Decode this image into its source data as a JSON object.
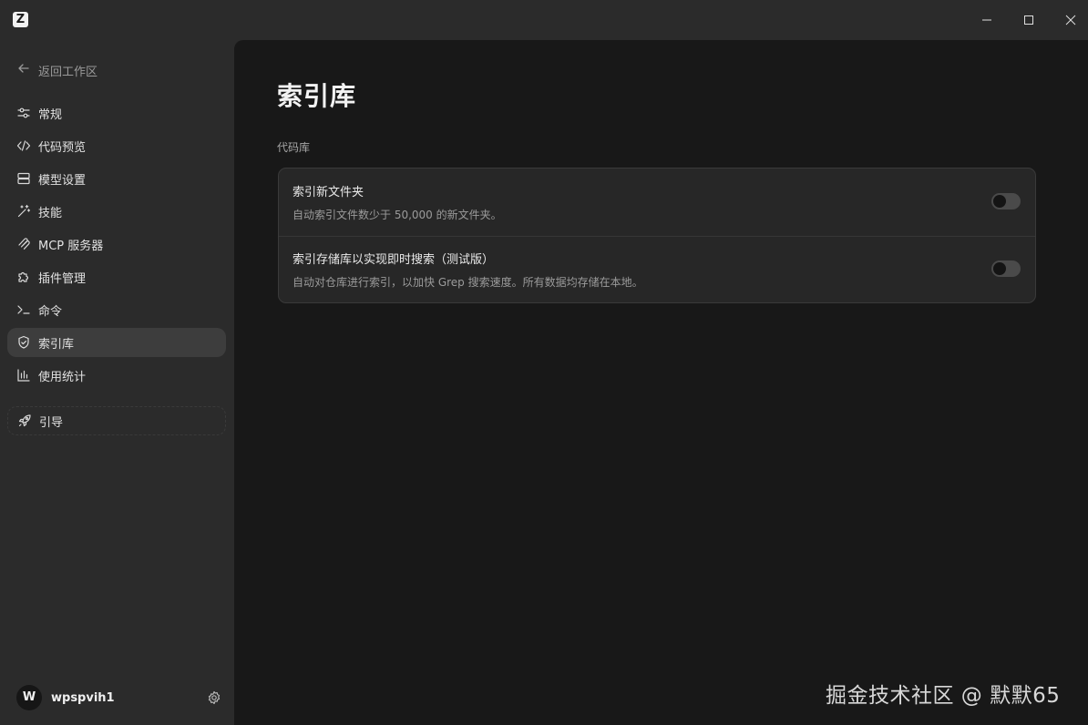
{
  "app": {
    "logo_letter": "Z"
  },
  "window_controls": {
    "minimize_icon": "minimize-icon",
    "maximize_icon": "maximize-icon",
    "close_icon": "close-icon"
  },
  "sidebar": {
    "back_label": "返回工作区",
    "items": [
      {
        "label": "常规",
        "icon": "sliders-icon",
        "active": false
      },
      {
        "label": "代码预览",
        "icon": "code-icon",
        "active": false
      },
      {
        "label": "模型设置",
        "icon": "server-icon",
        "active": false
      },
      {
        "label": "技能",
        "icon": "magic-wand-icon",
        "active": false
      },
      {
        "label": "MCP 服务器",
        "icon": "mcp-icon",
        "active": false
      },
      {
        "label": "插件管理",
        "icon": "puzzle-icon",
        "active": false
      },
      {
        "label": "命令",
        "icon": "terminal-icon",
        "active": false
      },
      {
        "label": "索引库",
        "icon": "shield-icon",
        "active": true
      },
      {
        "label": "使用统计",
        "icon": "bar-chart-icon",
        "active": false
      }
    ],
    "guide_label": "引导",
    "user": {
      "avatar_letter": "W",
      "name": "wpspvih1"
    }
  },
  "main": {
    "title": "索引库",
    "section_label": "代码库",
    "settings": [
      {
        "title": "索引新文件夹",
        "description": "自动索引文件数少于 50,000 的新文件夹。",
        "enabled": false
      },
      {
        "title": "索引存储库以实现即时搜索（测试版）",
        "description": "自动对仓库进行索引，以加快 Grep 搜索速度。所有数据均存储在本地。",
        "enabled": false
      }
    ]
  },
  "watermark": "掘金技术社区 @ 默默65",
  "colors": {
    "sidebar_bg": "#2b2b2b",
    "main_bg": "#181818",
    "card_bg": "#272727",
    "active_item_bg": "#3d3d3d",
    "toggle_off": "#4a4a4a"
  }
}
